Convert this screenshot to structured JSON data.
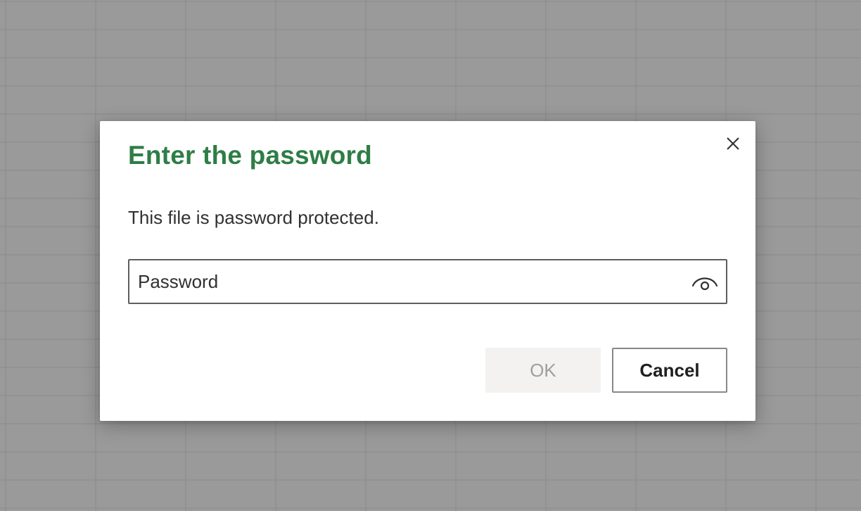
{
  "dialog": {
    "title": "Enter the password",
    "message": "This file is password protected.",
    "password_placeholder": "Password",
    "password_value": "",
    "ok_label": "OK",
    "ok_enabled": false,
    "cancel_label": "Cancel",
    "close_icon": "close-icon",
    "reveal_icon": "eye-icon"
  },
  "colors": {
    "title": "#2e7d46",
    "backdrop": "#9a9a9a",
    "ok_disabled_bg": "#f3f2f1",
    "ok_disabled_text": "#a19f9d"
  }
}
